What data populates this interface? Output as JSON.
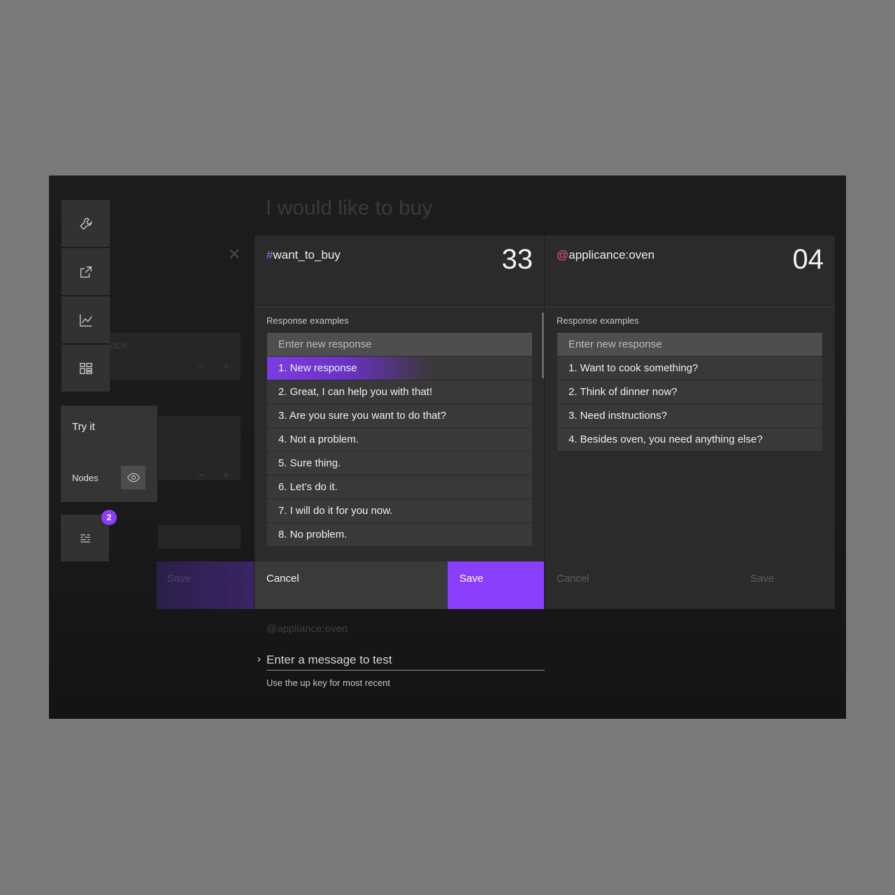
{
  "background": {
    "title": "I would like to buy",
    "entity_text": "@appliance:oven",
    "partial_field_text": "nce",
    "save_label": "Save"
  },
  "badge_count": "2",
  "try_it": {
    "label": "Try it",
    "nodes_label": "Nodes"
  },
  "panel1": {
    "hash": "#",
    "name": "want_to_buy",
    "count": "33",
    "section_label": "Response examples",
    "input_placeholder": "Enter new response",
    "items": [
      "1. New response",
      "2. Great, I can help you with that!",
      "3. Are you sure you want to do that?",
      "4. Not a problem.",
      "5. Sure thing.",
      "6. Let’s do it.",
      "7. I will do it for you now.",
      "8. No problem."
    ],
    "cancel": "Cancel",
    "save": "Save"
  },
  "panel2": {
    "at": "@",
    "name": "applicance:oven",
    "count": "04",
    "section_label": "Response examples",
    "input_placeholder": "Enter new response",
    "items": [
      "1. Want to cook something?",
      "2. Think of dinner now?",
      "3. Need instructions?",
      "4. Besides oven, you need anything else?"
    ],
    "cancel": "Cancel",
    "save": "Save"
  },
  "test": {
    "placeholder": "Enter a message to test",
    "helper": "Use the up key for most recent"
  },
  "colors": {
    "accent": "#8a3ffc",
    "hash": "#a56eff",
    "at": "#ee5396"
  }
}
